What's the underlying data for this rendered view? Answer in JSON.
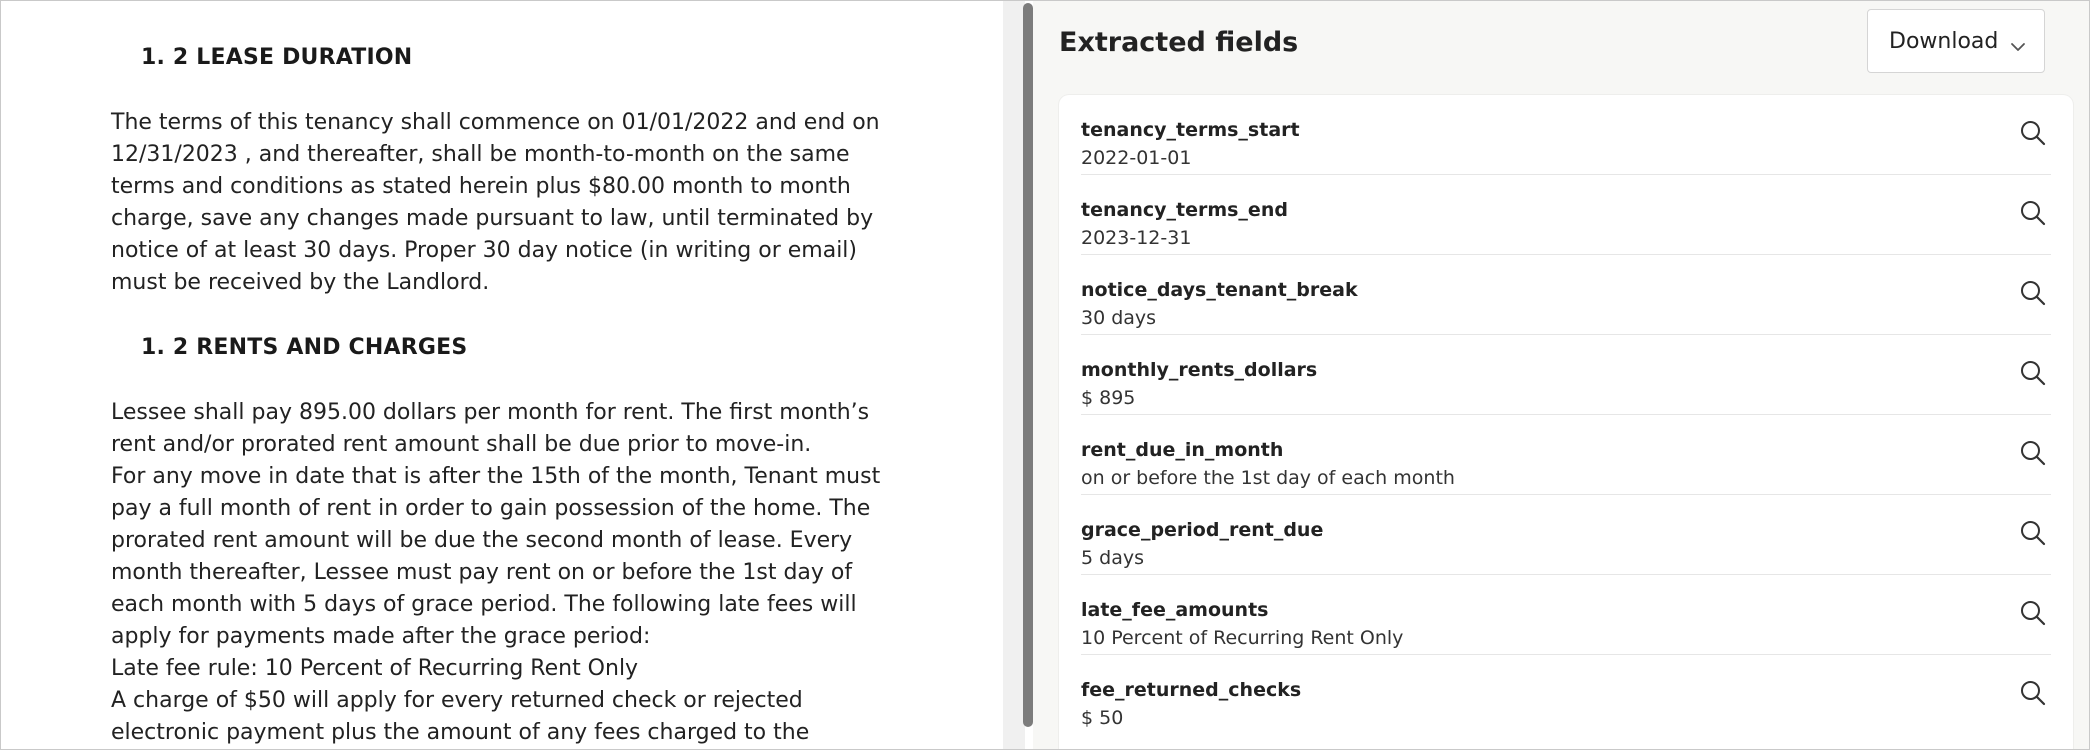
{
  "document": {
    "section1_heading": "1.  2 LEASE DURATION",
    "section1_lines": [
      "The terms of this tenancy shall commence on 01/01/2022 and end on",
      "12/31/2023 , and thereafter, shall be month-to-month on the same",
      "terms and conditions as stated herein plus $80.00 month to month",
      "charge, save any changes made pursuant to law, until terminated by",
      "notice of at least 30 days. Proper 30 day notice (in writing or email)",
      "must be received by the Landlord."
    ],
    "section2_heading": "1.  2 RENTS AND CHARGES",
    "section2_lines": [
      "Lessee shall pay 895.00 dollars per month for rent. The first month’s",
      "rent and/or prorated rent amount shall be due prior to move-in.",
      "For any move in date that is after the 15th of the month, Tenant must",
      "pay a full month of rent in order to gain possession of the home. The",
      "prorated rent amount will be due the second month of lease. Every",
      "month thereafter, Lessee must pay rent on or before the 1st day of",
      "each month with 5 days of grace period. The following late fees will",
      "apply for payments made after the grace period:",
      "Late fee rule: 10 Percent of Recurring Rent Only",
      "A charge of $50 will apply for every returned check or rejected",
      "electronic payment plus the amount of any fees charged to the"
    ]
  },
  "panel": {
    "title": "Extracted fields",
    "download_label": "Download",
    "fields": [
      {
        "name": "tenancy_terms_start",
        "value": "2022-01-01"
      },
      {
        "name": "tenancy_terms_end",
        "value": "2023-12-31"
      },
      {
        "name": "notice_days_tenant_break",
        "value": "30 days"
      },
      {
        "name": "monthly_rents_dollars",
        "value": "$ 895"
      },
      {
        "name": "rent_due_in_month",
        "value": "on or before the 1st day of each month"
      },
      {
        "name": "grace_period_rent_due",
        "value": "5 days"
      },
      {
        "name": "late_fee_amounts",
        "value": "10 Percent of Recurring Rent Only"
      },
      {
        "name": "fee_returned_checks",
        "value": "$ 50"
      }
    ]
  },
  "icons": {
    "field_action": "search-icon",
    "dropdown": "chevron-down-icon"
  }
}
